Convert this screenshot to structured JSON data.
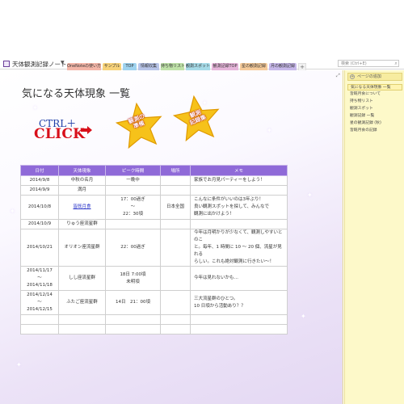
{
  "window": {
    "notebook_title": "天体観測記録ノート",
    "search_placeholder": "検索 (Ctrl+E)"
  },
  "tabs": [
    {
      "label": "OneNoteの使い方",
      "color": "#f4b6a8"
    },
    {
      "label": "サンプル",
      "color": "#f7d27a"
    },
    {
      "label": "TOP",
      "color": "#9fd3ef"
    },
    {
      "label": "情報収集",
      "color": "#b8c5e9"
    },
    {
      "label": "持ち物リスト",
      "color": "#bfe2a8"
    },
    {
      "label": "観測スポット",
      "color": "#a6dbe8"
    },
    {
      "label": "観測記録TOP",
      "color": "#e6b5da"
    },
    {
      "label": "星の観測記録",
      "color": "#f6cb9a"
    },
    {
      "label": "月の観測記録",
      "color": "#c7b8ea"
    }
  ],
  "page": {
    "title": "気になる天体現象 一覧",
    "ctrl_text": "CTRL＋",
    "click_text": "CLICK",
    "star1_label": [
      "観測の",
      "準備"
    ],
    "star2_label": [
      "観測",
      "記録集"
    ]
  },
  "table": {
    "headers": [
      "日付",
      "天体現象",
      "ピーク時間",
      "場所",
      "メモ"
    ],
    "rows": [
      {
        "date": [
          "2014/9/8"
        ],
        "event": "中秋の名月",
        "link": false,
        "peak": [
          "一晩中"
        ],
        "place": "",
        "memo": [
          "家族でお月見パーティーをしよう！"
        ]
      },
      {
        "date": [
          "2014/9/9"
        ],
        "event": "満月",
        "link": false,
        "peak": [
          ""
        ],
        "place": "",
        "memo": [
          ""
        ]
      },
      {
        "date": [
          "2014/10/8"
        ],
        "event": "皆既月食",
        "link": true,
        "peak": [
          "17：00過ぎ",
          "～",
          "22：30頃"
        ],
        "place": "日本全国",
        "memo": [
          "こんなに条件がいいのは3年ぶり！",
          "良い観測スポットを探して、みんなで",
          "観測に出かけよう！"
        ]
      },
      {
        "date": [
          "2014/10/9"
        ],
        "event": "りゅう座流星群",
        "link": false,
        "peak": [
          ""
        ],
        "place": "",
        "memo": [
          ""
        ]
      },
      {
        "date": [
          "2014/10/21"
        ],
        "event": "オリオン座流星群",
        "link": false,
        "peak": [
          "22：00過ぎ"
        ],
        "place": "",
        "memo": [
          "今年は月明かりが少なくて、観測しやすいとのこ",
          "と。毎年、1 時間に 10 ～ 20 個、流星が見れる",
          "らしい。これも絶対観測に行きたい～！"
        ]
      },
      {
        "date": [
          "2014/11/17",
          "～",
          "2014/11/18"
        ],
        "event": "しし座流星群",
        "link": false,
        "peak": [
          "18日 7:00頃",
          "未明頃"
        ],
        "place": "",
        "memo": [
          "今年は見れないかも…"
        ]
      },
      {
        "date": [
          "2014/12/14",
          "～",
          "2014/12/15"
        ],
        "event": "ふたご座流星群",
        "link": false,
        "peak": [
          "14日　21：00頃"
        ],
        "place": "",
        "memo": [
          "三大流星群のひとつ。",
          "10 日頃から活動あり？？"
        ]
      },
      {
        "date": [
          ""
        ],
        "event": "",
        "link": false,
        "peak": [
          ""
        ],
        "place": "",
        "memo": [
          ""
        ]
      },
      {
        "date": [
          ""
        ],
        "event": "",
        "link": false,
        "peak": [
          ""
        ],
        "place": "",
        "memo": [
          ""
        ]
      }
    ]
  },
  "sidebar": {
    "add_page": "ページの追加",
    "pages": [
      {
        "label": "気になる天体現象 一覧",
        "active": true
      },
      {
        "label": "皆既月食について",
        "active": false
      },
      {
        "label": "持ち物リスト",
        "active": false
      },
      {
        "label": "観測スポット",
        "active": false
      },
      {
        "label": "観測記録 一覧",
        "active": false
      },
      {
        "label": "星の観測記録 (秋)",
        "active": false
      },
      {
        "label": "皆既月食の記録",
        "active": false
      }
    ]
  }
}
